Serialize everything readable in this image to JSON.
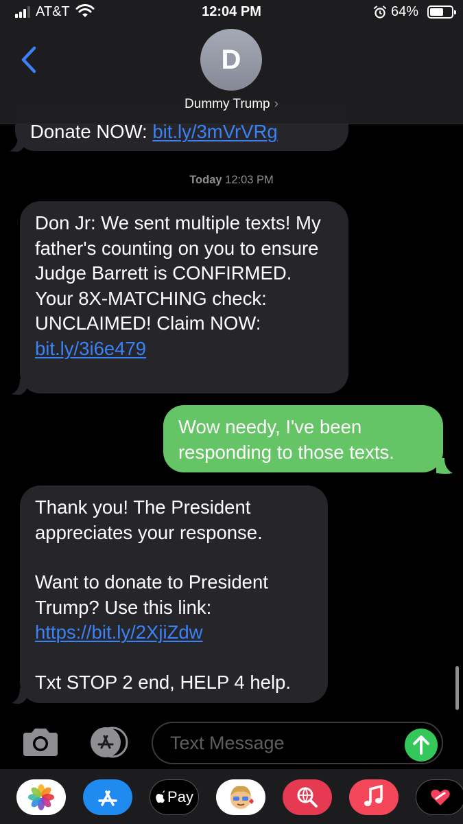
{
  "status_bar": {
    "carrier": "AT&T",
    "time": "12:04 PM",
    "battery_percent": "64%",
    "battery_level": 0.64
  },
  "header": {
    "back_icon": "chevron-left-icon",
    "avatar_initial": "D",
    "contact_name": "Dummy Trump",
    "contact_chevron": "›"
  },
  "thread": {
    "partial_message": {
      "text": "Donate NOW: ",
      "link": "bit.ly/3mVrVRg"
    },
    "timestamp_day": "Today",
    "timestamp_time": "12:03 PM",
    "message_1": {
      "text": "Don Jr: We sent multiple texts! My father's counting on you to ensure Judge Barrett is CONFIRMED. Your 8X-MATCHING check: UNCLAIMED! Claim NOW: ",
      "link": "bit.ly/3i6e479"
    },
    "reply": {
      "text": "Wow needy, I've been responding to those texts."
    },
    "message_2": {
      "line_1": "Thank you! The President appreciates your response.",
      "line_2": "Want to donate to President Trump? Use this link: ",
      "link": "https://bit.ly/2XjiZdw",
      "line_3": "Txt STOP 2 end, HELP 4 help."
    }
  },
  "composer": {
    "placeholder": "Text Message",
    "camera_icon": "camera-icon",
    "apps_icon": "app-store-icon",
    "send_icon": "send-arrow-icon"
  },
  "app_drawer": {
    "apps": [
      "photos-icon",
      "app-store-icon",
      "apple-pay-icon",
      "memoji-icon",
      "web-search-icon",
      "music-icon",
      "digital-touch-icon"
    ],
    "apple_pay_label": "Pay"
  },
  "colors": {
    "incoming_bubble": "#26252a",
    "outgoing_bubble": "#65c466",
    "link": "#3a82f6",
    "background": "#000000"
  }
}
